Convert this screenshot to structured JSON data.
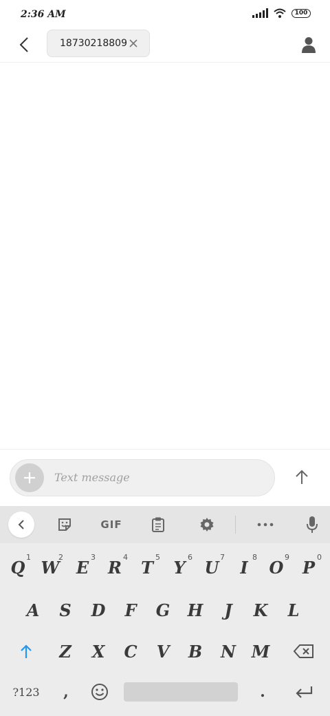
{
  "status_bar": {
    "time": "2:36 AM",
    "battery": "100"
  },
  "header": {
    "recipient": "18730218809"
  },
  "compose": {
    "placeholder": "Text message"
  },
  "keyboard": {
    "toolbar": {
      "gif_label": "GIF"
    },
    "row1": [
      {
        "letter": "Q",
        "hint": "1"
      },
      {
        "letter": "W",
        "hint": "2"
      },
      {
        "letter": "E",
        "hint": "3"
      },
      {
        "letter": "R",
        "hint": "4"
      },
      {
        "letter": "T",
        "hint": "5"
      },
      {
        "letter": "Y",
        "hint": "6"
      },
      {
        "letter": "U",
        "hint": "7"
      },
      {
        "letter": "I",
        "hint": "8"
      },
      {
        "letter": "O",
        "hint": "9"
      },
      {
        "letter": "P",
        "hint": "0"
      }
    ],
    "row2": [
      "A",
      "S",
      "D",
      "F",
      "G",
      "H",
      "J",
      "K",
      "L"
    ],
    "row3": [
      "Z",
      "X",
      "C",
      "V",
      "B",
      "N",
      "M"
    ],
    "symbols_label": "?123",
    "comma": ",",
    "period": "."
  },
  "colors": {
    "accent": "#2196f3",
    "keyboard_bg": "#ececec",
    "chip_bg": "#f0f0f0"
  }
}
